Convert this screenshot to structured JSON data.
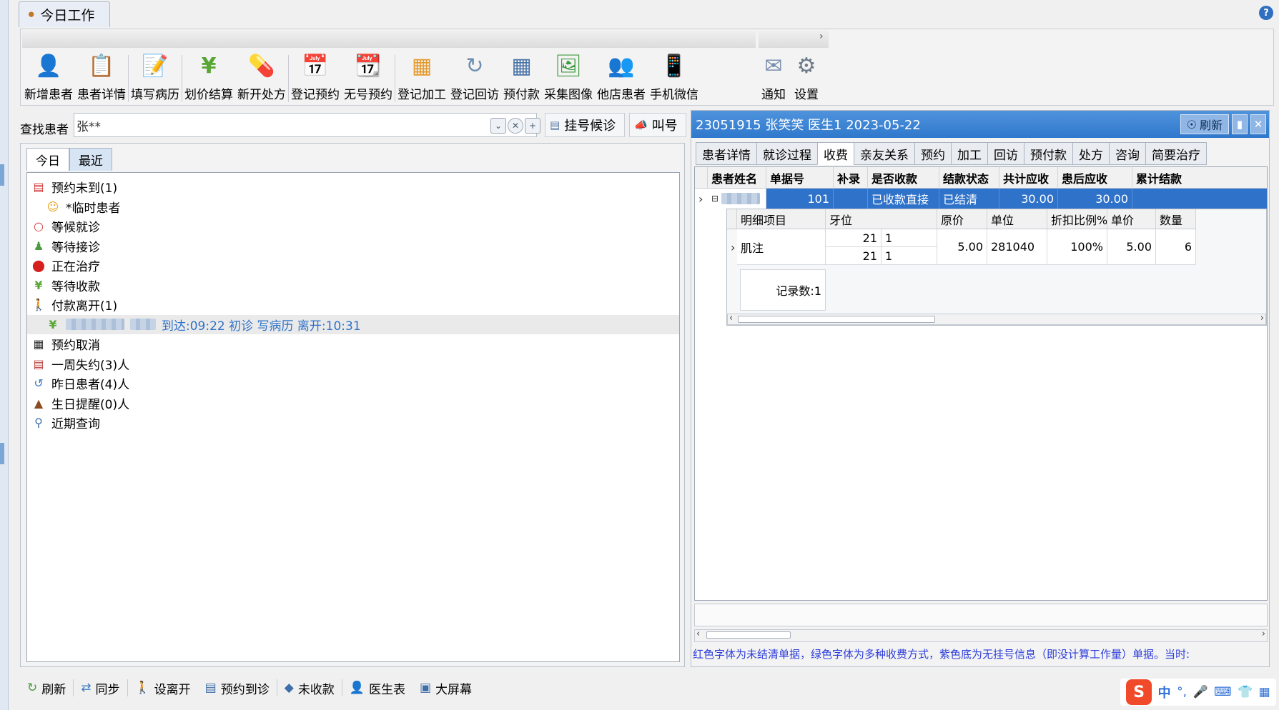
{
  "app": {
    "tab_title": "今日工作",
    "help": "?"
  },
  "toolbar": {
    "group1": [
      {
        "label": "新增患者",
        "icon": "add-patient-icon"
      },
      {
        "label": "患者详情",
        "icon": "patient-detail-icon"
      },
      {
        "label": "填写病历",
        "icon": "medical-record-icon"
      },
      {
        "label": "划价结算",
        "icon": "yen-icon"
      },
      {
        "label": "新开处方",
        "icon": "pill-icon"
      },
      {
        "label": "登记预约",
        "icon": "calendar-icon"
      },
      {
        "label": "无号预约",
        "icon": "calendar-grid-icon"
      },
      {
        "label": "登记加工",
        "icon": "boxes-icon"
      },
      {
        "label": "登记回访",
        "icon": "refresh-icon"
      },
      {
        "label": "预付款",
        "icon": "calculator-icon"
      },
      {
        "label": "采集图像",
        "icon": "image-icon"
      },
      {
        "label": "他店患者",
        "icon": "other-store-icon"
      },
      {
        "label": "手机微信",
        "icon": "phone-icon"
      }
    ],
    "group2": [
      {
        "label": "通知",
        "icon": "notice-icon"
      },
      {
        "label": "设置",
        "icon": "gear-icon"
      }
    ]
  },
  "search": {
    "label": "查找患者",
    "value": "张**",
    "reg_button": "挂号候诊",
    "call_button": "叫号"
  },
  "left": {
    "tabs": [
      "今日",
      "最近"
    ],
    "tree": [
      {
        "label": "预约未到(1)",
        "icon": "appointment-icon",
        "child": false
      },
      {
        "label": "*临时患者",
        "icon": "temp-patient-icon",
        "child": true
      },
      {
        "label": "等候就诊",
        "icon": "waiting-icon",
        "child": false
      },
      {
        "label": "等待接诊",
        "icon": "reception-icon",
        "child": false
      },
      {
        "label": "正在治疗",
        "icon": "treatment-icon",
        "child": false
      },
      {
        "label": "等待收款",
        "icon": "yen-icon",
        "child": false
      },
      {
        "label": "付款离开(1)",
        "icon": "walking-icon",
        "child": false
      },
      {
        "label": "到达:09:22 初诊 写病历 离开:10:31",
        "icon": "yen-icon",
        "child": true,
        "selected": true
      },
      {
        "label": "预约取消",
        "icon": "calendar-cancel-icon",
        "child": false
      },
      {
        "label": "一周失约(3)人",
        "icon": "calendar-miss-icon",
        "child": false
      },
      {
        "label": "昨日患者(4)人",
        "icon": "history-icon",
        "child": false
      },
      {
        "label": "生日提醒(0)人",
        "icon": "cake-icon",
        "child": false
      },
      {
        "label": "近期查询",
        "icon": "search-icon",
        "child": false
      }
    ]
  },
  "right": {
    "header": "23051915 张笑笑 医生1 2023-05-22",
    "refresh": "刷新",
    "tabs": [
      "患者详情",
      "就诊过程",
      "收费",
      "亲友关系",
      "预约",
      "加工",
      "回访",
      "预付款",
      "处方",
      "咨询",
      "简要治疗"
    ],
    "active_tab": 2,
    "grid_headers": [
      "患者姓名",
      "单据号",
      "补录",
      "是否收款",
      "结款状态",
      "共计应收",
      "患后应收",
      "累计结款"
    ],
    "grid_row": [
      "",
      "101",
      "",
      "已收款直接",
      "已结清",
      "30.00",
      "30.00",
      ""
    ],
    "sub_headers": [
      "明细项目",
      "牙位",
      "原价",
      "单位",
      "折扣比例%",
      "单价",
      "数量"
    ],
    "sub_row": {
      "item": "肌注",
      "tooth_a": "21",
      "tooth_b": "1",
      "tooth_c": "21",
      "tooth_d": "1",
      "price": "5.00",
      "unit": "281040",
      "discount": "100%",
      "unit_price": "5.00",
      "qty": "6"
    },
    "record_count": "记录数:1",
    "legend": "红色字体为未结清单据，绿色字体为多种收费方式，紫色底为无挂号信息（即没计算工作量）单据。当时:"
  },
  "bottom": [
    {
      "label": "刷新",
      "icon": "refresh-icon"
    },
    {
      "label": "同步",
      "icon": "sync-icon"
    },
    {
      "label": "设离开",
      "icon": "walking-icon"
    },
    {
      "label": "预约到诊",
      "icon": "list-icon"
    },
    {
      "label": "未收款",
      "icon": "tag-icon"
    },
    {
      "label": "医生表",
      "icon": "doctor-icon"
    },
    {
      "label": "大屏幕",
      "icon": "screen-icon"
    }
  ],
  "ime": {
    "s": "S",
    "zh": "中",
    "punct": "°,"
  }
}
